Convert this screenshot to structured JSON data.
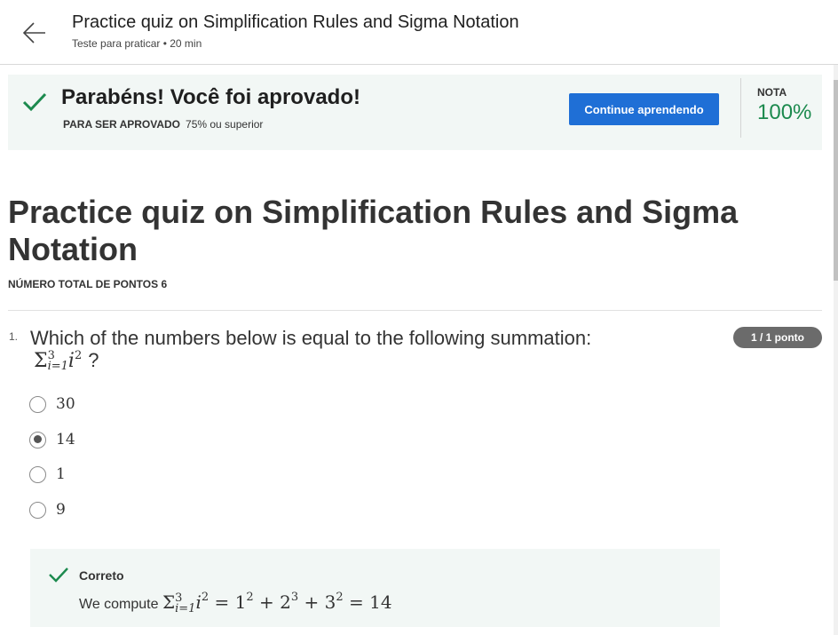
{
  "header": {
    "back_icon": "arrow-left-icon",
    "title": "Practice quiz on Simplification Rules and Sigma Notation",
    "subtitle": "Teste para praticar • 20 min"
  },
  "banner": {
    "check_icon": "check-icon",
    "title": "Parabéns! Você foi aprovado!",
    "req_label": "PARA SER APROVADO",
    "req_value": "75% ou superior",
    "continue_label": "Continue aprendendo",
    "grade_label": "NOTA",
    "grade_value": "100%",
    "colors": {
      "banner_bg": "#f2f7f5",
      "check": "#1c8a4e",
      "button": "#1f6fd6",
      "grade": "#1c8a4e"
    }
  },
  "page": {
    "title": "Practice quiz on Simplification Rules and Sigma Notation",
    "total_points": "NÚMERO TOTAL DE PONTOS 6"
  },
  "question": {
    "number": "1.",
    "text": "Which of the numbers below is equal to the following summation:",
    "math": {
      "symbol": "Σ",
      "upper": "3",
      "lower": "i=1",
      "base": "i",
      "exp": "2",
      "tail": "?"
    },
    "points": "1 / 1 ponto",
    "options": [
      {
        "label": "30",
        "selected": false
      },
      {
        "label": "14",
        "selected": true
      },
      {
        "label": "1",
        "selected": false
      },
      {
        "label": "9",
        "selected": false
      }
    ]
  },
  "feedback": {
    "check_icon": "check-icon",
    "label": "Correto",
    "text_prefix": "We compute",
    "math": {
      "symbol": "Σ",
      "upper": "3",
      "lower": "i=1",
      "base": "i",
      "exp": "2",
      "eq1": "=",
      "t1": "1",
      "t1_exp": "2",
      "plus1": "+",
      "t2": "2",
      "t2_exp": "3",
      "plus2": "+",
      "t3": "3",
      "t3_exp": "2",
      "eq2": "=",
      "result": "14"
    }
  }
}
